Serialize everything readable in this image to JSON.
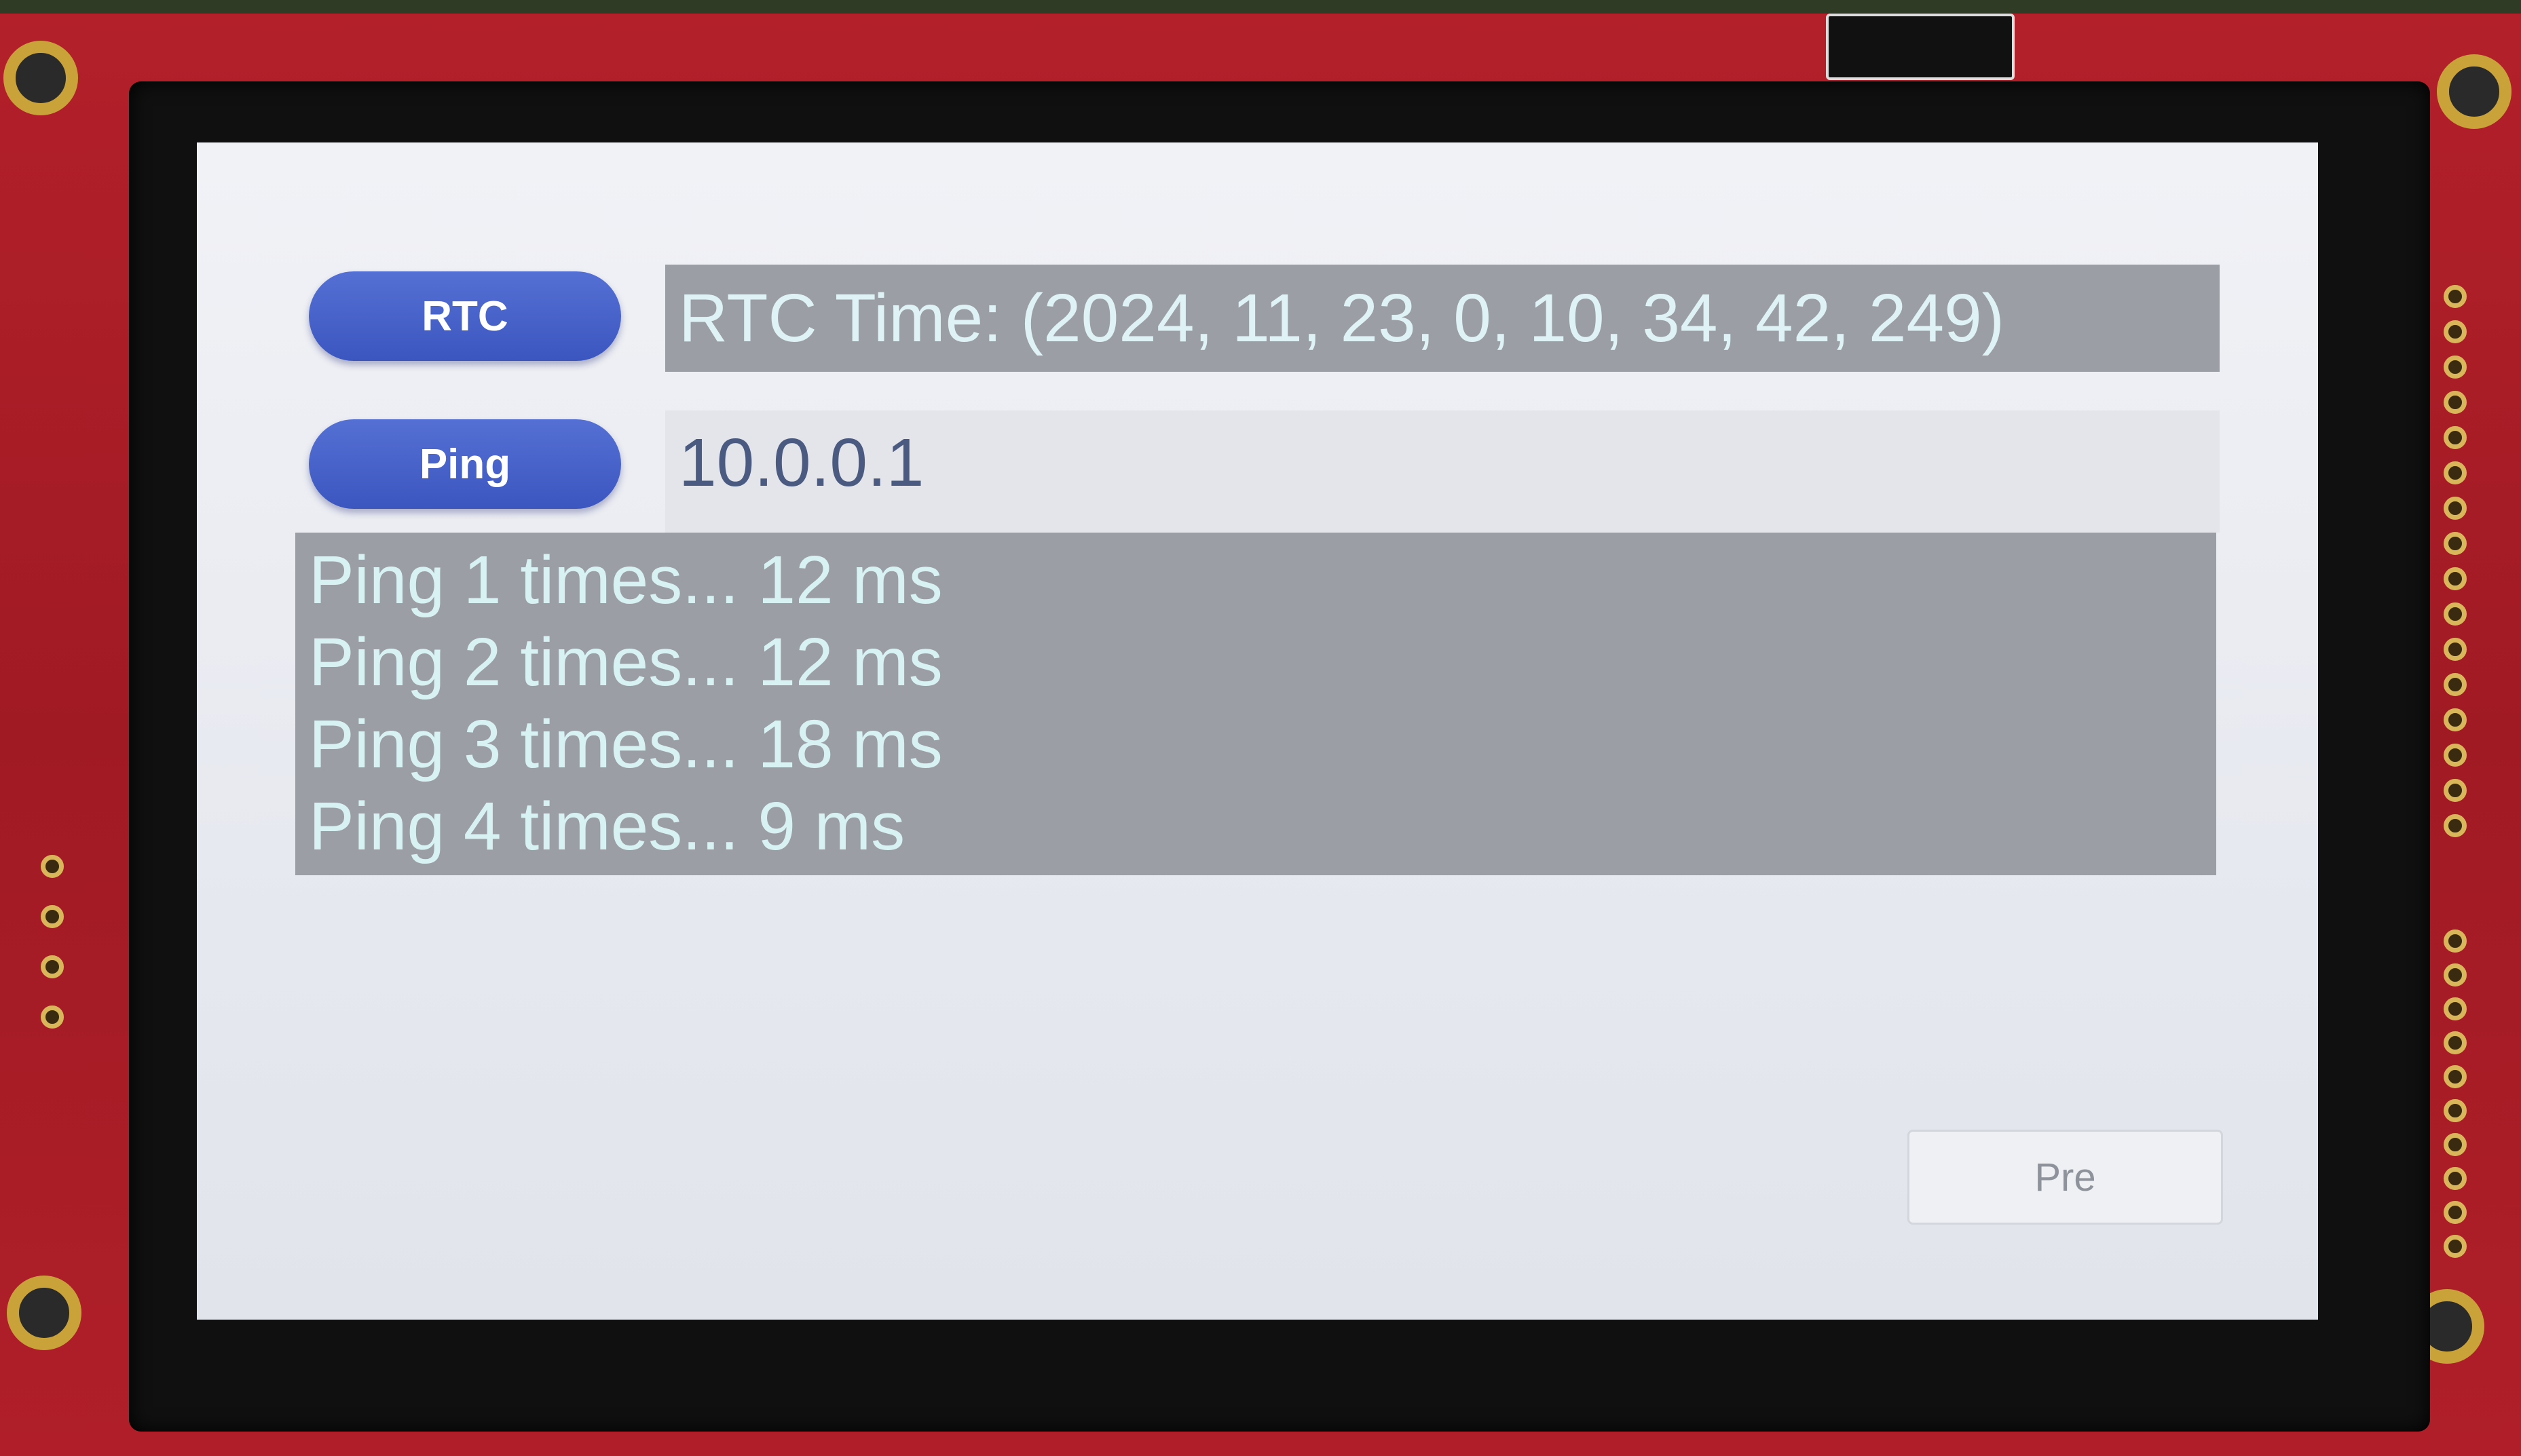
{
  "screen": {
    "rtc_button": "RTC",
    "ping_button": "Ping",
    "rtc_time": "RTC Time: (2024, 11, 23, 0, 10, 34, 42, 249)",
    "ip_address": "10.0.0.1",
    "ping_log": [
      "Ping 1 times... 12 ms",
      "Ping 2 times... 12 ms",
      "Ping 3 times... 18 ms",
      "Ping 4 times... 9 ms"
    ],
    "pre_button": "Pre"
  },
  "colors": {
    "button_blue": "#3b56bf",
    "label_gray": "#9b9ea4",
    "label_text": "#dff3f6",
    "pcb_red": "#b3202a"
  }
}
